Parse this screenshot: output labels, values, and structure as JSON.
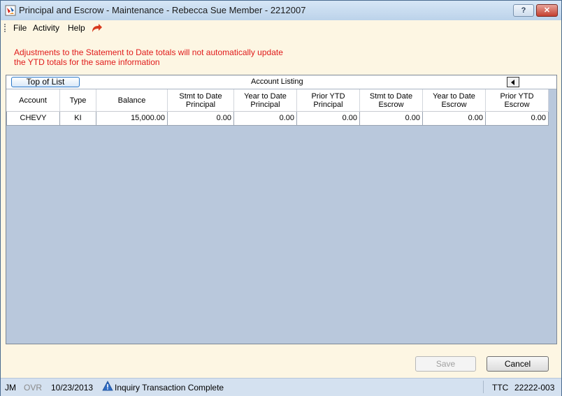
{
  "window": {
    "title": "Principal and Escrow - Maintenance - Rebecca Sue Member - 2212007",
    "help_label": "?",
    "close_label": "✕"
  },
  "menu": {
    "items": [
      "File",
      "Activity",
      "Help"
    ]
  },
  "notice": "Adjustments to the Statement to Date totals will not automatically update the YTD totals for the same information",
  "grid": {
    "top_button": "Top of List",
    "caption": "Account Listing",
    "columns": [
      "Account",
      "Type",
      "Balance",
      "Stmt to Date\nPrincipal",
      "Year to Date\nPrincipal",
      "Prior YTD\nPrincipal",
      "Stmt to Date\nEscrow",
      "Year to Date\nEscrow",
      "Prior YTD\nEscrow"
    ],
    "rows": [
      [
        "CHEVY",
        "KI",
        "15,000.00",
        "0.00",
        "0.00",
        "0.00",
        "0.00",
        "0.00",
        "0.00"
      ]
    ]
  },
  "buttons": {
    "save": "Save",
    "cancel": "Cancel"
  },
  "status": {
    "user": "JM",
    "ovr": "OVR",
    "date": "10/23/2013",
    "message": "Inquiry Transaction Complete",
    "ttc_label": "TTC",
    "ttc_code": "22222-003"
  },
  "colors": {
    "warning_text": "#e01a1a",
    "grid_background": "#b9c8dc",
    "status_bar": "#d4e1f0"
  }
}
